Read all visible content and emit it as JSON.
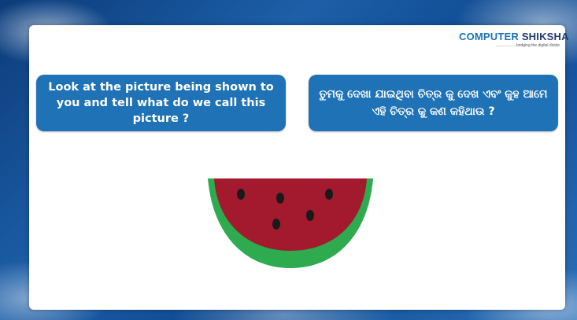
{
  "logo": {
    "brand_first": "COMPUTER",
    "brand_second": "SHIKSHA",
    "tagline": "...................bridging the digital divide"
  },
  "question": {
    "english": "Look at the picture being shown to you and tell what do we call this picture ?",
    "odia": "ତୁମକୁ ଦେଖା ଯାଇଥିବା ଚିତ୍ର କୁ ଦେଖ ଏବଂ କୁହ ଆମେ ଏହି ଚିତ୍ର କୁ କଣ କହିଥାଉ ?"
  },
  "colors": {
    "bubble": "#1f72b5",
    "melon_flesh": "#a3192e",
    "melon_rind": "#2eaa4f",
    "seed": "#1a1a1a"
  },
  "icons": [
    "watermelon-slice-icon"
  ]
}
